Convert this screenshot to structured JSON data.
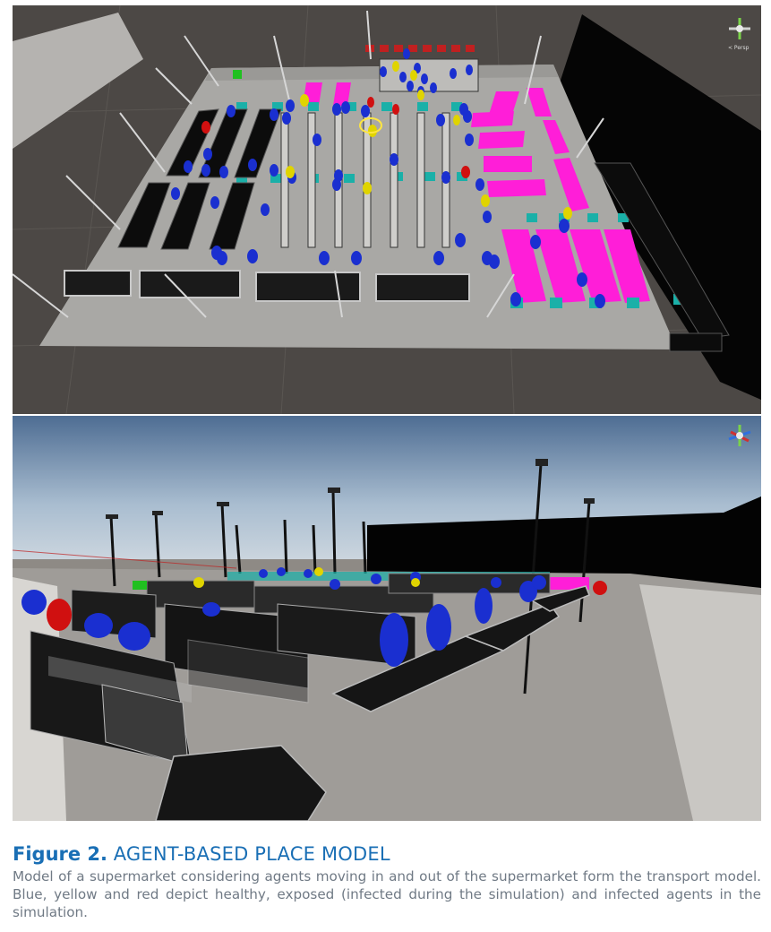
{
  "figure": {
    "label": "Figure 2.",
    "title": "AGENT-BASED PLACE MODEL",
    "caption": "Model of a supermarket considering agents moving in and out of the supermarket form the transport model. Blue, yellow and red depict healthy, exposed (infected during the simulation) and infected agents in the simulation."
  },
  "views": {
    "top": {
      "gizmo_label": "< Persp",
      "gizmo_icon": "scene-orientation-gizmo-icon"
    },
    "bottom": {
      "gizmo_icon": "scene-orientation-gizmo-icon"
    }
  },
  "colors": {
    "healthy": "#1a2fd0",
    "exposed": "#e0d400",
    "infected": "#d01010",
    "zone": "#ff1ed8",
    "marker": "#1ab0a8",
    "caption_title": "#1a6fb5",
    "caption_text": "#707a85"
  }
}
